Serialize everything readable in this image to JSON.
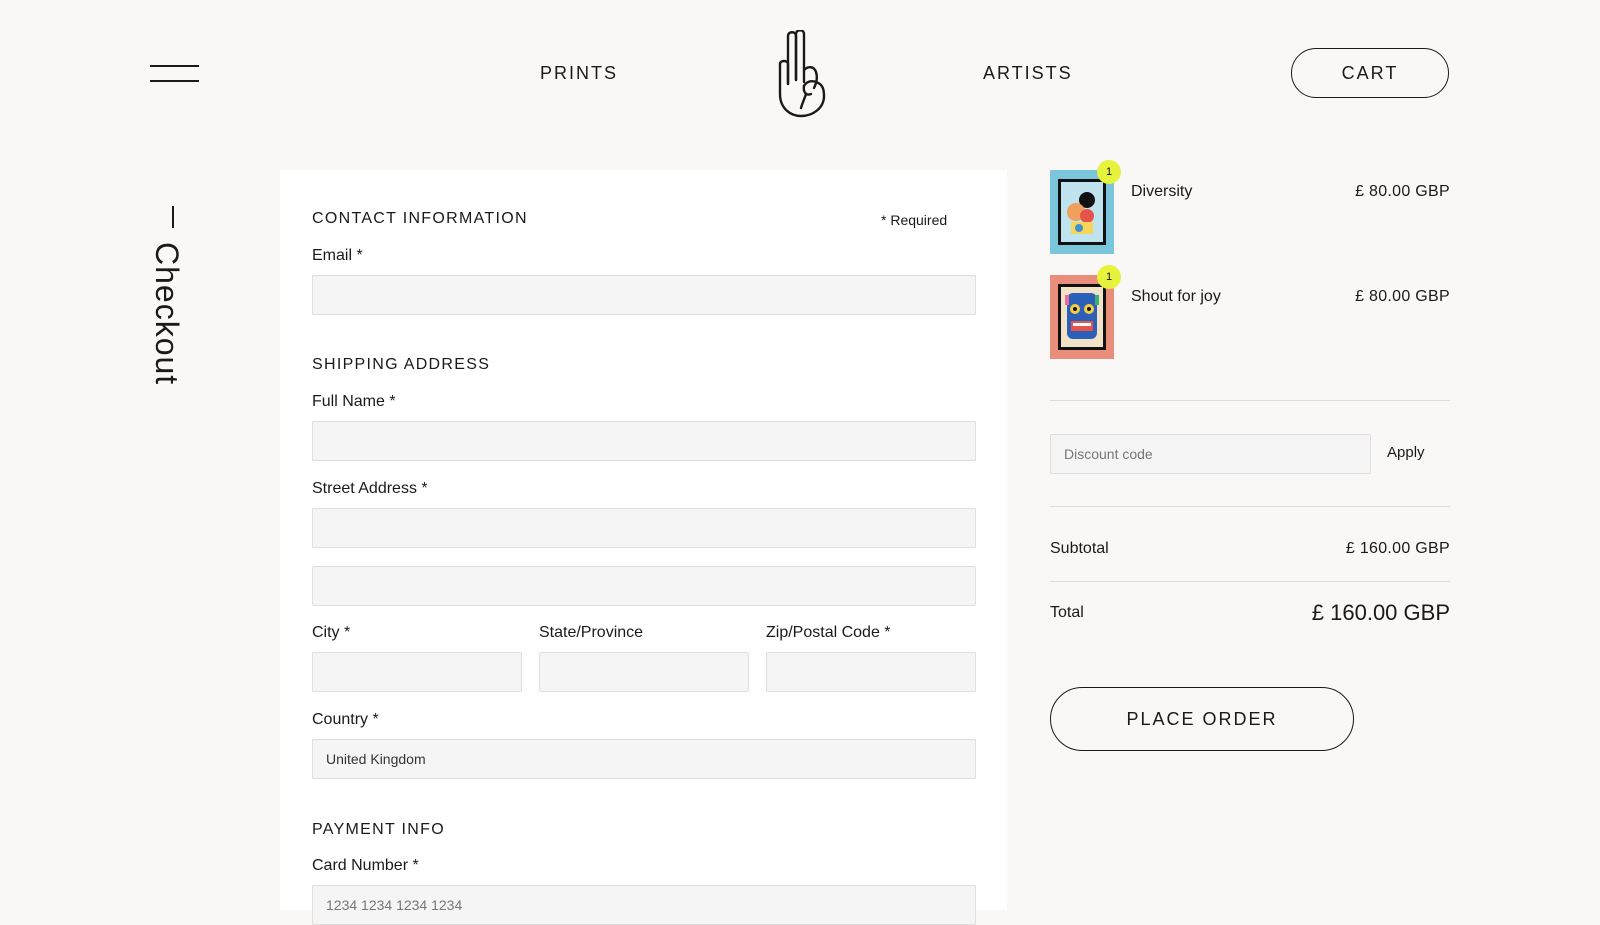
{
  "header": {
    "menu_icon": "hamburger-menu-icon",
    "nav_prints": "PRINTS",
    "nav_artists": "ARTISTS",
    "logo_icon": "hand-logo-icon",
    "cart_label": "CART"
  },
  "page": {
    "title": "Checkout"
  },
  "form": {
    "contact_title": "CONTACT INFORMATION",
    "required_note": "* Required",
    "email_label": "Email *",
    "email_value": "",
    "shipping_title": "SHIPPING ADDRESS",
    "full_name_label": "Full Name *",
    "street_label": "Street Address *",
    "city_label": "City *",
    "state_label": "State/Province",
    "zip_label": "Zip/Postal Code *",
    "country_label": "Country *",
    "country_value": "United Kingdom",
    "payment_title": "PAYMENT INFO",
    "card_label": "Card Number *",
    "card_placeholder": "1234 1234 1234 1234"
  },
  "cart": {
    "items": [
      {
        "name": "Diversity",
        "price": "£ 80.00 GBP",
        "quantity": "1",
        "thumb_bg": "#7cc6dc"
      },
      {
        "name": "Shout for joy",
        "price": "£ 80.00 GBP",
        "quantity": "1",
        "thumb_bg": "#e98e7a"
      }
    ],
    "discount_placeholder": "Discount code",
    "apply_label": "Apply",
    "subtotal_label": "Subtotal",
    "subtotal_value": "£ 160.00 GBP",
    "total_label": "Total",
    "total_value": "£ 160.00 GBP",
    "place_order_label": "PLACE ORDER"
  },
  "colors": {
    "background": "#f9f8f6",
    "card": "#ffffff",
    "badge": "#e6f23c",
    "text": "#1a1a1a"
  }
}
